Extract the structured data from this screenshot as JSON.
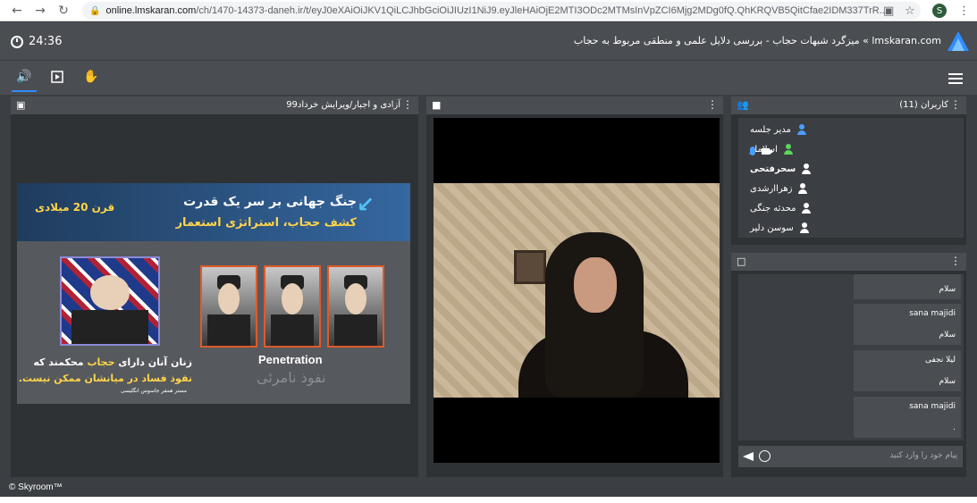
{
  "browser": {
    "url_host": "online.lmskaran.com",
    "url_path": "/ch/1470-14373-daneh.ir/t/eyJ0eXAiOiJKV1QiLCJhbGciOiJIUzI1NiJ9.eyJleHAiOjE2MTI3ODc2MTMsInVpZCI6Mjg2MDg0fQ.QhKRQVB5QitCfae2IDM337TrR...",
    "profile_initial": "S"
  },
  "topbar": {
    "timer": "24:36",
    "room_title": "lmskaran.com » میزگرد شبهات حجاب - بررسی دلایل علمی و منطقی مربوط به حجاب"
  },
  "slide_panel": {
    "title": "آزادی و اجبار/ویرایش خرداد99",
    "slide": {
      "century": "قرن 20 میلادی",
      "heading1": "جنگ جهانی بر سر یک قدرت",
      "heading2": "کشف حجاب، استراتژی استعمار",
      "penetration_en": "Penetration",
      "penetration_fa": "نفوذ نامرئی",
      "quote_part1": "زنان آنان دارای ",
      "quote_highlight": "حجاب",
      "quote_part2": " محکمند که",
      "quote_line2": "نفوذ فساد در میانشان ممکن نیست.",
      "quote_source": "مستر همفر جاسوس انگلیسی"
    }
  },
  "users_panel": {
    "title": "کاربران (11)",
    "users": [
      {
        "name": "مدیر جلسه",
        "color": "#4a9eff"
      },
      {
        "name": "اسلاملو",
        "color": "#5cd65c"
      },
      {
        "name": "سحرفتحی",
        "color": "#ffffff"
      },
      {
        "name": "زهراارشدی",
        "color": "#ffffff"
      },
      {
        "name": "محدثه جنگی",
        "color": "#ffffff"
      },
      {
        "name": "سوسن دلیر",
        "color": "#ffffff"
      }
    ]
  },
  "chat_panel": {
    "messages": [
      {
        "name": "",
        "text": "سلام"
      },
      {
        "name": "sana majidi",
        "text": "سلام"
      },
      {
        "name": "لیلا نجفی",
        "text": "سلام"
      },
      {
        "name": "sana majidi",
        "text": "."
      }
    ],
    "input_placeholder": "پیام خود را وارد کنید"
  },
  "footer": {
    "copyright": "© Skyroom™"
  },
  "colors": {
    "accent": "#2f8dff",
    "panel_bg": "#2f3235",
    "header_bg": "#4a4d51"
  },
  "icons": [
    "clock-icon",
    "speaker-icon",
    "play-icon",
    "hand-icon",
    "menu-icon",
    "users-icon",
    "chat-icon",
    "video-icon",
    "mic-icon",
    "camera-icon",
    "send-icon",
    "emoji-icon"
  ]
}
